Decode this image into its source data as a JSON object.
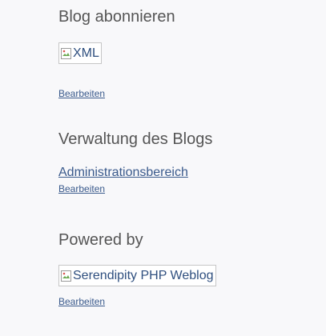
{
  "sidebar": {
    "sections": [
      {
        "title": "Blog abonnieren",
        "image_alt": "XML",
        "edit_label": "Bearbeiten"
      },
      {
        "title": "Verwaltung des Blogs",
        "link_label": "Administrationsbereich",
        "edit_label": "Bearbeiten"
      },
      {
        "title": "Powered by",
        "image_alt": "Serendipity PHP Weblog",
        "edit_label": "Bearbeiten"
      }
    ]
  },
  "icons": {
    "broken_image": "broken-image-icon"
  },
  "colors": {
    "background": "#f8f8fa",
    "heading": "#555555",
    "link": "#3a5a8c"
  }
}
